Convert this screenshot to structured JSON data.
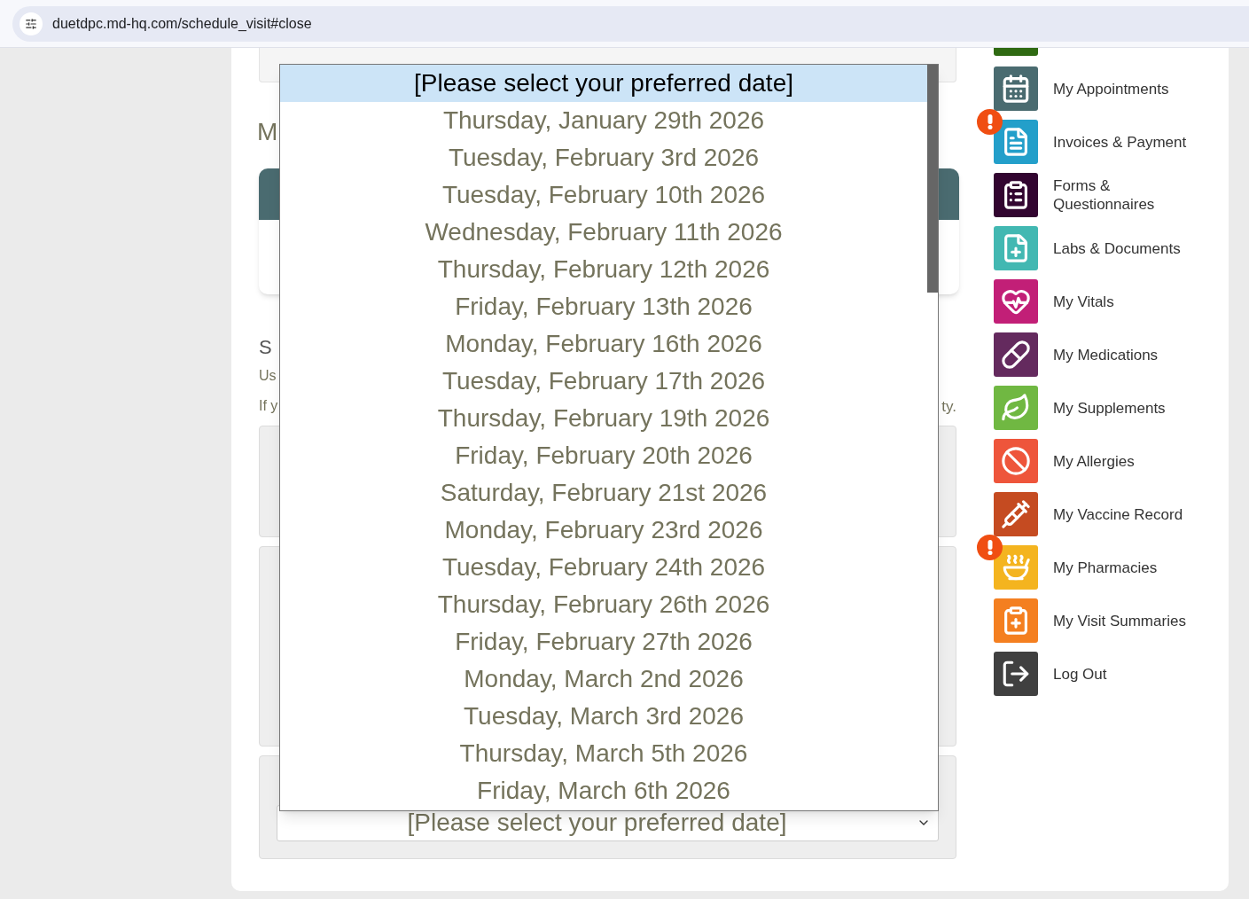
{
  "browser": {
    "url": "duetdpc.md-hq.com/schedule_visit#close"
  },
  "page": {
    "heading": "M",
    "section_title": "S",
    "line_1": "Us",
    "line_2_start": "If y",
    "line_2_end": "ty."
  },
  "date_select": {
    "value": "[Please select your preferred date]"
  },
  "dropdown": {
    "options": [
      {
        "label": "[Please select your preferred date]",
        "selected": true
      },
      {
        "label": "Thursday, January 29th 2026",
        "selected": false
      },
      {
        "label": "Tuesday, February 3rd 2026",
        "selected": false
      },
      {
        "label": "Tuesday, February 10th 2026",
        "selected": false
      },
      {
        "label": "Wednesday, February 11th 2026",
        "selected": false
      },
      {
        "label": "Thursday, February 12th 2026",
        "selected": false
      },
      {
        "label": "Friday, February 13th 2026",
        "selected": false
      },
      {
        "label": "Monday, February 16th 2026",
        "selected": false
      },
      {
        "label": "Tuesday, February 17th 2026",
        "selected": false
      },
      {
        "label": "Thursday, February 19th 2026",
        "selected": false
      },
      {
        "label": "Friday, February 20th 2026",
        "selected": false
      },
      {
        "label": "Saturday, February 21st 2026",
        "selected": false
      },
      {
        "label": "Monday, February 23rd 2026",
        "selected": false
      },
      {
        "label": "Tuesday, February 24th 2026",
        "selected": false
      },
      {
        "label": "Thursday, February 26th 2026",
        "selected": false
      },
      {
        "label": "Friday, February 27th 2026",
        "selected": false
      },
      {
        "label": "Monday, March 2nd 2026",
        "selected": false
      },
      {
        "label": "Tuesday, March 3rd 2026",
        "selected": false
      },
      {
        "label": "Thursday, March 5th 2026",
        "selected": false
      },
      {
        "label": "Friday, March 6th 2026",
        "selected": false
      }
    ]
  },
  "sidebar": {
    "items": [
      {
        "label": "My Appointments",
        "color": "#4a6b70",
        "alert": false
      },
      {
        "label": "Invoices & Payment",
        "color": "#239fca",
        "alert": true
      },
      {
        "label": "Forms & Questionnaires",
        "color": "#320530",
        "alert": false
      },
      {
        "label": "Labs & Documents",
        "color": "#42b8b2",
        "alert": false
      },
      {
        "label": "My Vitals",
        "color": "#c21f77",
        "alert": false
      },
      {
        "label": "My Medications",
        "color": "#642a5e",
        "alert": false
      },
      {
        "label": "My Supplements",
        "color": "#70b842",
        "alert": false
      },
      {
        "label": "My Allergies",
        "color": "#ee553b",
        "alert": false
      },
      {
        "label": "My Vaccine Record",
        "color": "#c54b21",
        "alert": false
      },
      {
        "label": "My Pharmacies",
        "color": "#f4b41f",
        "alert": true
      },
      {
        "label": "My Visit Summaries",
        "color": "#f47f20",
        "alert": false
      },
      {
        "label": "Log Out",
        "color": "#404040",
        "alert": false
      }
    ]
  }
}
